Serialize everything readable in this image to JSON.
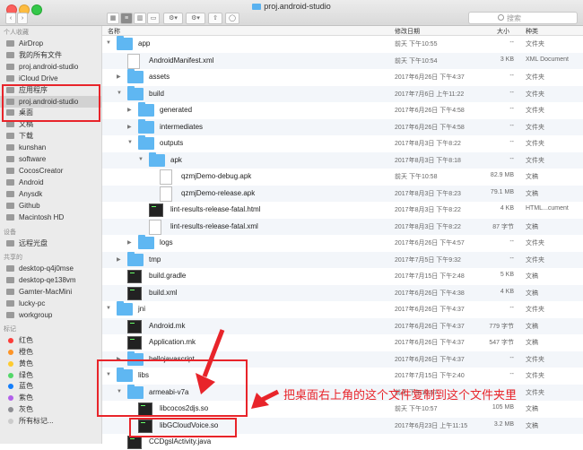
{
  "window": {
    "title": "proj.android-studio",
    "search_placeholder": "搜索"
  },
  "sidebar": {
    "favorites_label": "个人收藏",
    "favorites": [
      {
        "label": "AirDrop",
        "icon": "airdrop-icon"
      },
      {
        "label": "我的所有文件",
        "icon": "all-files-icon"
      },
      {
        "label": "proj.android-studio",
        "icon": "folder-icon"
      },
      {
        "label": "iCloud Drive",
        "icon": "cloud-icon"
      },
      {
        "label": "应用程序",
        "icon": "applications-icon"
      },
      {
        "label": "proj.android-studio",
        "icon": "folder-icon",
        "selected": true
      },
      {
        "label": "桌面",
        "icon": "desktop-icon"
      },
      {
        "label": "文稿",
        "icon": "documents-icon"
      },
      {
        "label": "下载",
        "icon": "downloads-icon"
      },
      {
        "label": "kunshan",
        "icon": "home-icon"
      },
      {
        "label": "software",
        "icon": "folder-icon"
      },
      {
        "label": "CocosCreator",
        "icon": "folder-icon"
      },
      {
        "label": "Android",
        "icon": "folder-icon"
      },
      {
        "label": "Anysdk",
        "icon": "folder-icon"
      },
      {
        "label": "Github",
        "icon": "folder-icon"
      },
      {
        "label": "Macintosh HD",
        "icon": "disk-icon"
      }
    ],
    "devices_label": "设备",
    "devices": [
      {
        "label": "远程光盘",
        "icon": "remote-disc-icon"
      }
    ],
    "shared_label": "共享的",
    "shared": [
      {
        "label": "desktop-q4j0mse",
        "icon": "computer-icon"
      },
      {
        "label": "desktop-qe138vm",
        "icon": "computer-icon"
      },
      {
        "label": "Gamter-MacMini",
        "icon": "computer-icon"
      },
      {
        "label": "lucky-pc",
        "icon": "computer-icon"
      },
      {
        "label": "workgroup",
        "icon": "network-icon"
      }
    ],
    "tags_label": "标记",
    "tags": [
      {
        "label": "红色",
        "color": "#fc3d39"
      },
      {
        "label": "橙色",
        "color": "#fd9426"
      },
      {
        "label": "黄色",
        "color": "#fecb2f"
      },
      {
        "label": "绿色",
        "color": "#53d769"
      },
      {
        "label": "蓝色",
        "color": "#147efb"
      },
      {
        "label": "紫色",
        "color": "#b260ea"
      },
      {
        "label": "灰色",
        "color": "#8e8e93"
      },
      {
        "label": "所有标记...",
        "color": "#cccccc"
      }
    ]
  },
  "columns": {
    "name": "名称",
    "date": "修改日期",
    "size": "大小",
    "kind": "种类"
  },
  "rows": [
    {
      "name": "app",
      "date": "前天 下午10:55",
      "size": "--",
      "kind": "文件夹",
      "type": "folder",
      "depth": 0,
      "arrow": "open"
    },
    {
      "name": "AndroidManifest.xml",
      "date": "前天 下午10:54",
      "size": "3 KB",
      "kind": "XML Document",
      "type": "doc",
      "depth": 1,
      "arrow": ""
    },
    {
      "name": "assets",
      "date": "2017年6月26日 下午4:37",
      "size": "--",
      "kind": "文件夹",
      "type": "folder",
      "depth": 1,
      "arrow": "closed"
    },
    {
      "name": "build",
      "date": "2017年7月6日 上午11:22",
      "size": "--",
      "kind": "文件夹",
      "type": "folder",
      "depth": 1,
      "arrow": "open"
    },
    {
      "name": "generated",
      "date": "2017年6月26日 下午4:58",
      "size": "--",
      "kind": "文件夹",
      "type": "folder",
      "depth": 2,
      "arrow": "closed"
    },
    {
      "name": "intermediates",
      "date": "2017年6月26日 下午4:58",
      "size": "--",
      "kind": "文件夹",
      "type": "folder",
      "depth": 2,
      "arrow": "closed"
    },
    {
      "name": "outputs",
      "date": "2017年8月3日 下午8:22",
      "size": "--",
      "kind": "文件夹",
      "type": "folder",
      "depth": 2,
      "arrow": "open"
    },
    {
      "name": "apk",
      "date": "2017年8月3日 下午8:18",
      "size": "--",
      "kind": "文件夹",
      "type": "folder",
      "depth": 3,
      "arrow": "open"
    },
    {
      "name": "qzmjDemo-debug.apk",
      "date": "前天 下午10:58",
      "size": "82.9 MB",
      "kind": "文稿",
      "type": "doc",
      "depth": 4,
      "arrow": ""
    },
    {
      "name": "qzmjDemo-release.apk",
      "date": "2017年8月3日 下午8:23",
      "size": "79.1 MB",
      "kind": "文稿",
      "type": "doc",
      "depth": 4,
      "arrow": ""
    },
    {
      "name": "lint-results-release-fatal.html",
      "date": "2017年8月3日 下午8:22",
      "size": "4 KB",
      "kind": "HTML...cument",
      "type": "html",
      "depth": 3,
      "arrow": ""
    },
    {
      "name": "lint-results-release-fatal.xml",
      "date": "2017年8月3日 下午8:22",
      "size": "87 字节",
      "kind": "文稿",
      "type": "doc",
      "depth": 3,
      "arrow": ""
    },
    {
      "name": "logs",
      "date": "2017年6月26日 下午4:57",
      "size": "--",
      "kind": "文件夹",
      "type": "folder",
      "depth": 2,
      "arrow": "closed"
    },
    {
      "name": "tmp",
      "date": "2017年7月5日 下午9:32",
      "size": "--",
      "kind": "文件夹",
      "type": "folder",
      "depth": 1,
      "arrow": "closed"
    },
    {
      "name": "build.gradle",
      "date": "2017年7月15日 下午2:48",
      "size": "5 KB",
      "kind": "文稿",
      "type": "term",
      "depth": 1,
      "arrow": ""
    },
    {
      "name": "build.xml",
      "date": "2017年6月26日 下午4:38",
      "size": "4 KB",
      "kind": "文稿",
      "type": "term",
      "depth": 1,
      "arrow": ""
    },
    {
      "name": "jni",
      "date": "2017年6月26日 下午4:37",
      "size": "--",
      "kind": "文件夹",
      "type": "folder",
      "depth": 0,
      "arrow": "open"
    },
    {
      "name": "Android.mk",
      "date": "2017年6月26日 下午4:37",
      "size": "779 字节",
      "kind": "文稿",
      "type": "term",
      "depth": 1,
      "arrow": ""
    },
    {
      "name": "Application.mk",
      "date": "2017年6月26日 下午4:37",
      "size": "547 字节",
      "kind": "文稿",
      "type": "term",
      "depth": 1,
      "arrow": ""
    },
    {
      "name": "hellojavascript",
      "date": "2017年6月26日 下午4:37",
      "size": "--",
      "kind": "文件夹",
      "type": "folder",
      "depth": 1,
      "arrow": "closed"
    },
    {
      "name": "libs",
      "date": "2017年7月15日 下午2:40",
      "size": "--",
      "kind": "文件夹",
      "type": "folder",
      "depth": 0,
      "arrow": "open"
    },
    {
      "name": "armeabi-v7a",
      "date": "前天 下午10:57",
      "size": "--",
      "kind": "文件夹",
      "type": "folder",
      "depth": 1,
      "arrow": "open"
    },
    {
      "name": "libcocos2djs.so",
      "date": "前天 下午10:57",
      "size": "105 MB",
      "kind": "文稿",
      "type": "term",
      "depth": 2,
      "arrow": ""
    },
    {
      "name": "libGCloudVoice.so",
      "date": "2017年6月23日 上午11:15",
      "size": "3.2 MB",
      "kind": "文稿",
      "type": "term",
      "depth": 2,
      "arrow": ""
    },
    {
      "name": "CCDgslActivity.java",
      "date": "",
      "size": "",
      "kind": "",
      "type": "term",
      "depth": 1,
      "arrow": ""
    }
  ],
  "annotation": {
    "text": "把桌面右上角的这个文件复制到这个文件夹里",
    "color": "#e8242a"
  }
}
